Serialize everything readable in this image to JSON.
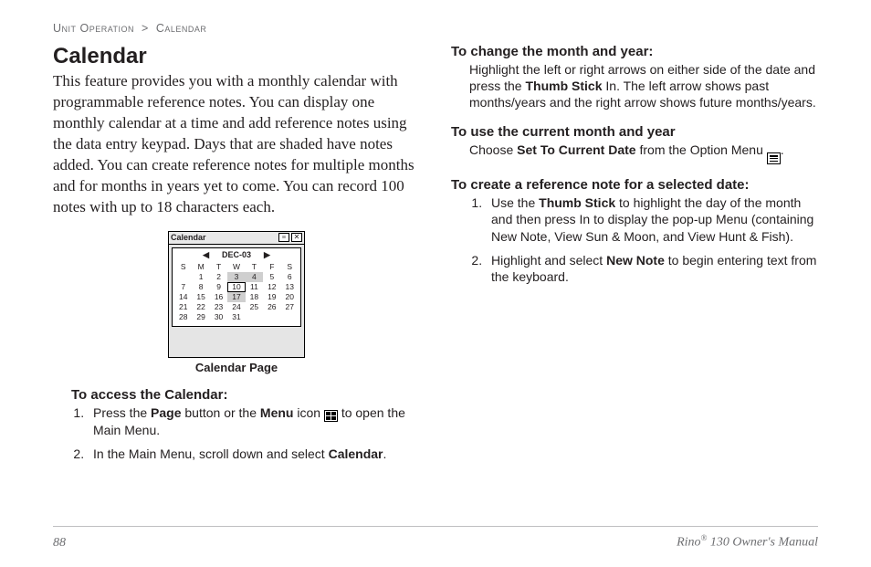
{
  "breadcrumb": {
    "a": "Unit Operation",
    "sep": ">",
    "b": "Calendar"
  },
  "title": "Calendar",
  "intro": "This feature provides you with a monthly calendar with programmable reference notes. You can display one monthly calendar at a time and add reference notes using the data entry keypad. Days that are shaded have notes added. You can create reference notes for multiple months and for months in years yet to come. You can record 100 notes with up to 18 characters each.",
  "figure": {
    "caption": "Calendar Page",
    "win_title": "Calendar",
    "month": "DEC-03",
    "dow": [
      "S",
      "M",
      "T",
      "W",
      "T",
      "F",
      "S"
    ],
    "rows": [
      [
        "",
        "1",
        "2",
        "3",
        "4",
        "5",
        "6"
      ],
      [
        "7",
        "8",
        "9",
        "10",
        "11",
        "12",
        "13"
      ],
      [
        "14",
        "15",
        "16",
        "17",
        "18",
        "19",
        "20"
      ],
      [
        "21",
        "22",
        "23",
        "24",
        "25",
        "26",
        "27"
      ],
      [
        "28",
        "29",
        "30",
        "31",
        "",
        "",
        ""
      ]
    ],
    "shaded": [
      "3",
      "4",
      "17"
    ],
    "selected": "10"
  },
  "left": {
    "h1": "To access the Calendar:",
    "s1a": "Press the ",
    "s1b": "Page",
    "s1c": " button or the ",
    "s1d": "Menu",
    "s1e": " icon ",
    "s1f": " to open the Main Menu.",
    "s2a": "In the Main Menu, scroll down and select ",
    "s2b": "Calendar",
    "s2c": "."
  },
  "right": {
    "h1": "To change the month and year:",
    "p1a": "Highlight the left or right arrows on either side of the date and press the ",
    "p1b": "Thumb Stick",
    "p1c": " In. The left arrow shows past months/years and the right arrow shows future months/years.",
    "h2": "To use the current month and year",
    "p2a": "Choose ",
    "p2b": "Set To Current Date",
    "p2c": " from the Option Menu ",
    "p2d": ".",
    "h3": "To create a reference note for a selected date:",
    "s1a": "Use the ",
    "s1b": "Thumb Stick",
    "s1c": " to highlight the day of the month and then press In to display the pop-up Menu (containing New Note, View Sun & Moon, and View Hunt & Fish).",
    "s2a": "Highlight and select ",
    "s2b": "New Note",
    "s2c": " to begin entering text from the keyboard."
  },
  "footer": {
    "page": "88",
    "manual_pre": "Rino",
    "manual_reg": "®",
    "manual_post": " 130 Owner's Manual"
  }
}
